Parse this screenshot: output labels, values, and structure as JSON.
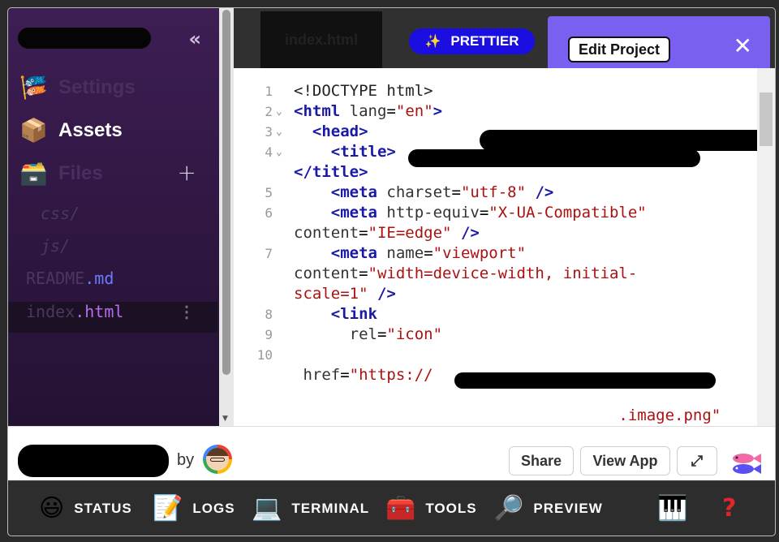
{
  "sidebar": {
    "collapse_icon": "«",
    "nav": [
      {
        "label": "Settings",
        "emoji": "🎏"
      },
      {
        "label": "Assets",
        "emoji": "📦"
      },
      {
        "label": "Files",
        "emoji": "🗃️"
      }
    ],
    "add_icon": "+",
    "files": [
      {
        "base": "css/",
        "ext": ""
      },
      {
        "base": "js/",
        "ext": ""
      },
      {
        "base": "README",
        "ext": ".md"
      },
      {
        "base": "index",
        "ext": ".html",
        "more": "⋮"
      }
    ]
  },
  "editor": {
    "tab_label": "index.html",
    "prettier_label": "PRETTIER",
    "prettier_icon": "✨",
    "popup": {
      "edit_label": "Edit Project",
      "close_icon": "✕"
    },
    "lines": [
      {
        "n": "1",
        "fold": "",
        "html": "<span class='pl'>&lt;!DOCTYPE html&gt;</span>"
      },
      {
        "n": "2",
        "fold": "⌄",
        "html": "<span class='tg'>&lt;html</span> <span class='at'>lang</span>=<span class='st'>\"en\"</span><span class='tg'>&gt;</span>"
      },
      {
        "n": "3",
        "fold": "⌄",
        "html": "  <span class='tg'>&lt;head&gt;</span>"
      },
      {
        "n": "4",
        "fold": "⌄",
        "html": "    <span class='tg'>&lt;title&gt;</span>"
      },
      {
        "n": "",
        "fold": "",
        "html": "<span class='tg'>&lt;/title&gt;</span>"
      },
      {
        "n": "5",
        "fold": "",
        "html": "    <span class='tg'>&lt;meta</span> <span class='at'>charset</span>=<span class='st'>\"utf-8\"</span> <span class='tg'>/&gt;</span>"
      },
      {
        "n": "6",
        "fold": "",
        "html": "    <span class='tg'>&lt;meta</span> <span class='at'>http-equiv</span>=<span class='st'>\"X-UA-Compatible\"</span>"
      },
      {
        "n": "",
        "fold": "",
        "html": "<span class='at'>content</span>=<span class='st'>\"IE=edge\"</span> <span class='tg'>/&gt;</span>"
      },
      {
        "n": "7",
        "fold": "",
        "html": "    <span class='tg'>&lt;meta</span> <span class='at'>name</span>=<span class='st'>\"viewport\"</span>"
      },
      {
        "n": "",
        "fold": "",
        "html": "<span class='at'>content</span>=<span class='st'>\"width=device-width, initial-</span>"
      },
      {
        "n": "",
        "fold": "",
        "html": "<span class='st'>scale=1\"</span> <span class='tg'>/&gt;</span>"
      },
      {
        "n": "8",
        "fold": "",
        "html": "    <span class='tg'>&lt;link</span>"
      },
      {
        "n": "9",
        "fold": "",
        "html": "      <span class='at'>rel</span>=<span class='st'>\"icon\"</span>"
      },
      {
        "n": "10",
        "fold": "",
        "html": ""
      },
      {
        "n": "",
        "fold": "",
        "html": " <span class='at'>href</span>=<span class='st'>\"https://</span>"
      },
      {
        "n": "",
        "fold": "",
        "html": ""
      },
      {
        "n": "",
        "fold": "",
        "html": "                                   <span class='st'>.image.png\"</span>"
      }
    ]
  },
  "footer": {
    "by_text": "by",
    "share_label": "Share",
    "view_label": "View App",
    "expand_icon": "⤢"
  },
  "toolbar": [
    {
      "label": "STATUS",
      "icon": "😃"
    },
    {
      "label": "LOGS",
      "icon": "📝"
    },
    {
      "label": "TERMINAL",
      "icon": "💻"
    },
    {
      "label": "TOOLS",
      "icon": "🧰"
    },
    {
      "label": "PREVIEW",
      "icon": "🔎"
    },
    {
      "label": "",
      "icon": "🎹"
    },
    {
      "label": "",
      "icon": "?"
    }
  ]
}
